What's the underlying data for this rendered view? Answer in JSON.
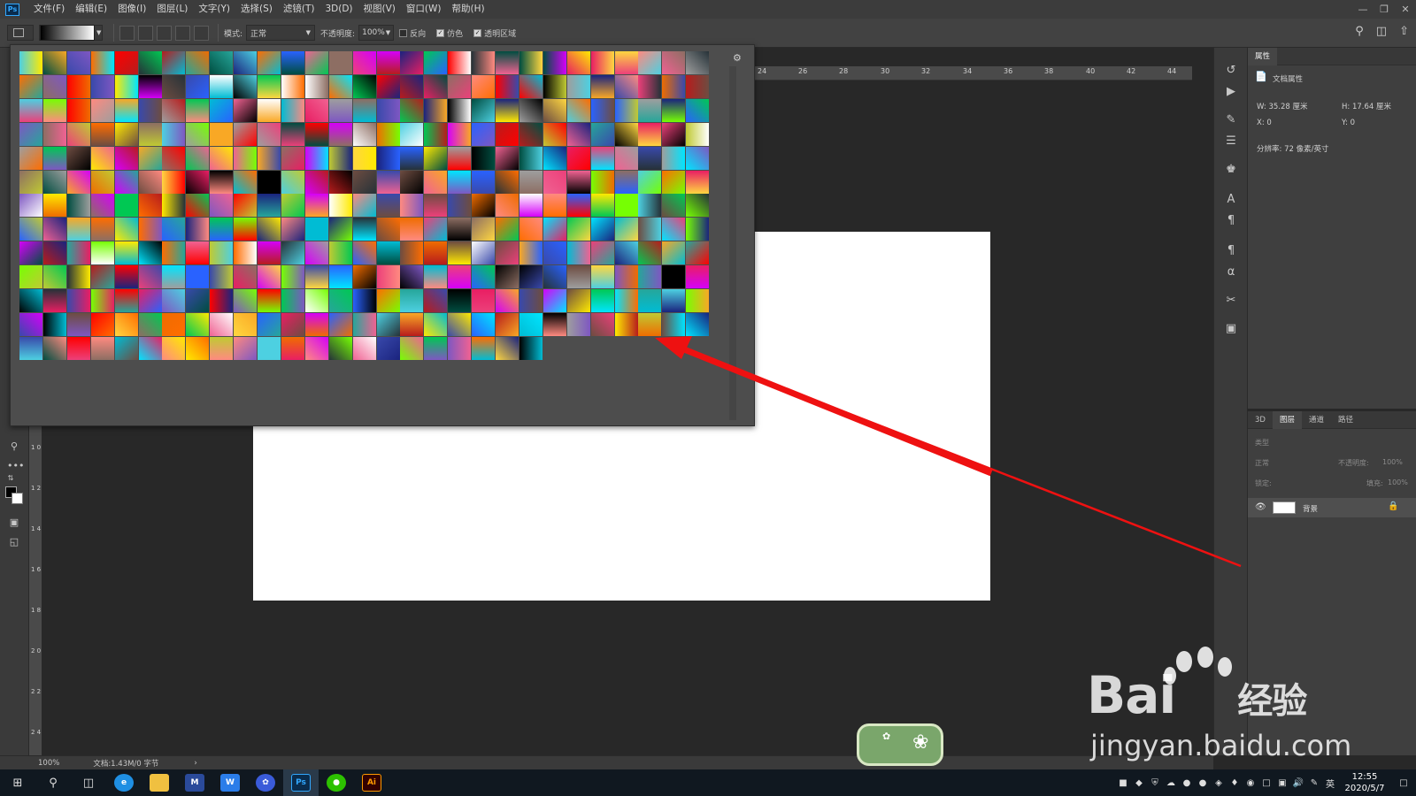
{
  "menu": {
    "logo": "Ps",
    "items": [
      "文件(F)",
      "编辑(E)",
      "图像(I)",
      "图层(L)",
      "文字(Y)",
      "选择(S)",
      "滤镜(T)",
      "3D(D)",
      "视图(V)",
      "窗口(W)",
      "帮助(H)"
    ]
  },
  "options": {
    "mode_label": "模式:",
    "mode_value": "正常",
    "opacity_label": "不透明度:",
    "opacity_value": "100%",
    "reverse_label": "反向",
    "reverse_checked": false,
    "dither_label": "仿色",
    "dither_checked": true,
    "transparency_label": "透明区域",
    "transparency_checked": true
  },
  "ruler": {
    "h_ticks": [
      "24",
      "26",
      "28",
      "30",
      "32",
      "34",
      "36",
      "38",
      "40",
      "42",
      "44"
    ],
    "v_ticks": [
      "1 0",
      "1 2",
      "1 4",
      "1 6",
      "1 8",
      "2 0",
      "2 2",
      "2 4"
    ]
  },
  "status": {
    "zoom": "100%",
    "doc_info": "文档:1.43M/0 字节"
  },
  "properties": {
    "tab": "属性",
    "section": "文档属性",
    "width": "W:  35.28 厘米",
    "height": "H:  17.64 厘米",
    "x": "X:  0",
    "y": "Y:  0",
    "resolution": "分辨率: 72 像素/英寸"
  },
  "layers": {
    "tabs": [
      "3D",
      "图层",
      "通道",
      "路径"
    ],
    "filter_label": "类型",
    "blend_mode": "正常",
    "opacity_label": "不透明度:",
    "opacity_value": "100%",
    "lock_label": "锁定:",
    "fill_label": "填充:",
    "fill_value": "100%",
    "layer_name": "背景"
  },
  "watermark": {
    "brand": "Bai",
    "brand_suffix": "经验",
    "url": "jingyan.baidu.com"
  },
  "taskbar": {
    "apps": [
      "ps",
      "ai"
    ],
    "app_labels": [
      "Ps",
      "Ai"
    ],
    "time": "12:55",
    "date": "2020/5/7",
    "lang": "英"
  },
  "colors": {
    "accent": "#31a8ff",
    "arrow": "#ee1111",
    "canvas_bg": "#282828",
    "panel_bg": "#3f3f3f"
  }
}
